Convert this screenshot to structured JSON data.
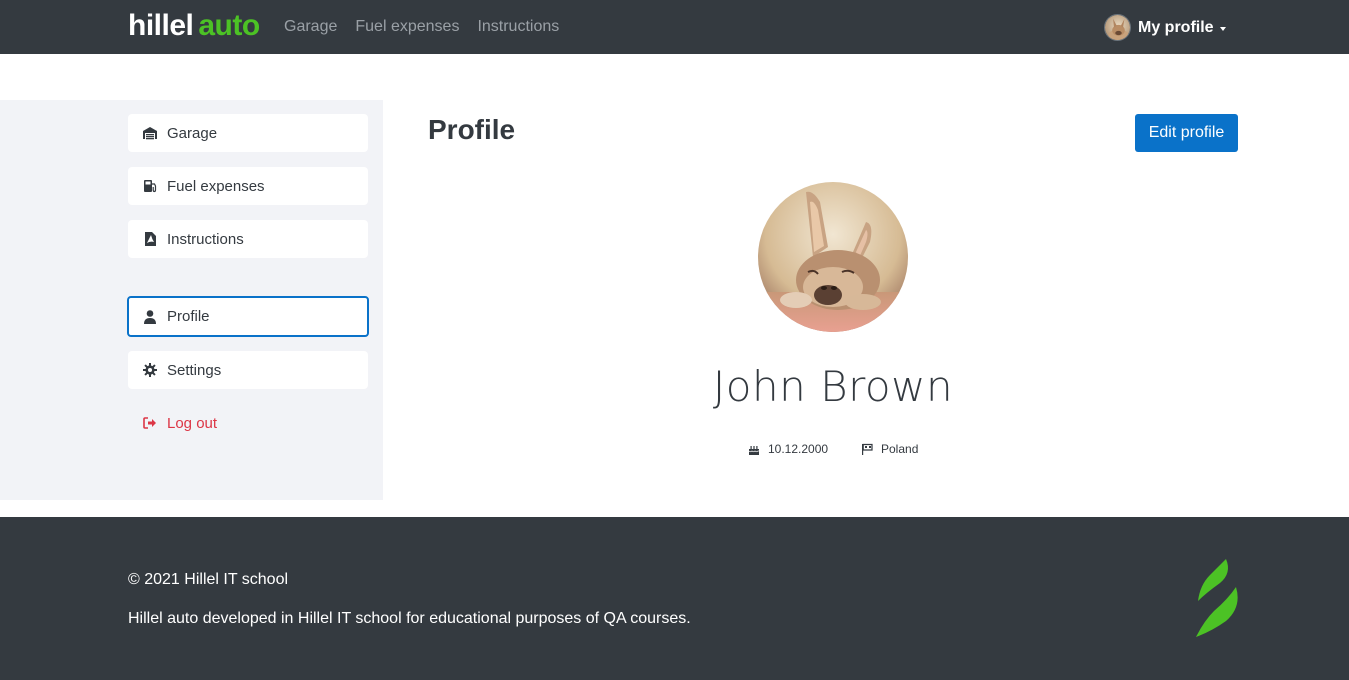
{
  "header": {
    "logo_part1": "hillel",
    "logo_part2": "auto",
    "nav": [
      "Garage",
      "Fuel expenses",
      "Instructions"
    ],
    "profile_menu_label": "My profile"
  },
  "sidebar": {
    "items": [
      {
        "label": "Garage",
        "icon": "garage-icon"
      },
      {
        "label": "Fuel expenses",
        "icon": "fuel-pump-icon"
      },
      {
        "label": "Instructions",
        "icon": "file-pdf-icon"
      },
      {
        "label": "Profile",
        "icon": "user-icon",
        "active": true
      },
      {
        "label": "Settings",
        "icon": "gear-icon"
      },
      {
        "label": "Log out",
        "icon": "logout-icon"
      }
    ]
  },
  "main": {
    "title": "Profile",
    "edit_button": "Edit profile",
    "name": "John Brown",
    "birthday": "10.12.2000",
    "country": "Poland"
  },
  "footer": {
    "copyright": "© 2021 Hillel IT school",
    "description": "Hillel auto developed in Hillel IT school for educational purposes of QA courses."
  },
  "colors": {
    "header_bg": "#343a40",
    "brand_green": "#4cc225",
    "primary_blue": "#0a72c9",
    "danger_red": "#dc3545",
    "sidebar_bg": "#f2f3f7"
  }
}
